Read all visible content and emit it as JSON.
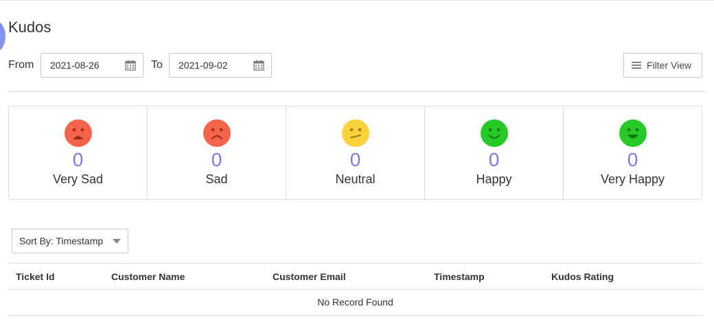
{
  "page": {
    "title": "Kudos"
  },
  "filters": {
    "from_label": "From",
    "from_value": "2021-08-26",
    "to_label": "To",
    "to_value": "2021-09-02",
    "filter_view_label": "Filter View"
  },
  "ratings": [
    {
      "label": "Very Sad",
      "count": "0",
      "color": "#f4644a",
      "icon": "very-sad-face-icon"
    },
    {
      "label": "Sad",
      "count": "0",
      "color": "#f4644a",
      "icon": "sad-face-icon"
    },
    {
      "label": "Neutral",
      "count": "0",
      "color": "#f7d23a",
      "icon": "neutral-face-icon"
    },
    {
      "label": "Happy",
      "count": "0",
      "color": "#26c926",
      "icon": "happy-face-icon"
    },
    {
      "label": "Very Happy",
      "count": "0",
      "color": "#26c926",
      "icon": "very-happy-face-icon"
    }
  ],
  "sort": {
    "label": "Sort By: Timestamp"
  },
  "table": {
    "columns": [
      "Ticket Id",
      "Customer Name",
      "Customer Email",
      "Timestamp",
      "Kudos Rating"
    ],
    "empty_message": "No Record Found"
  },
  "colors": {
    "count_accent": "#7f78e0",
    "side_bubble": "#8493f0"
  }
}
